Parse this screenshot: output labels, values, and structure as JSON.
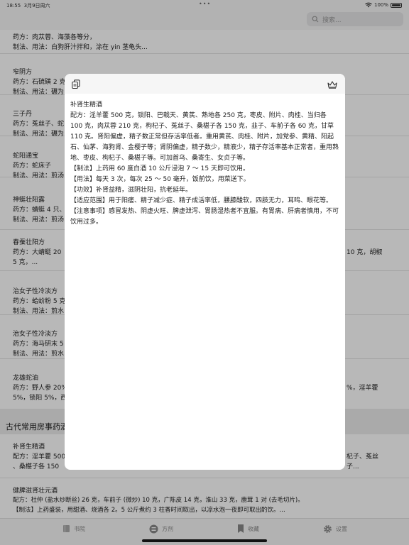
{
  "status_bar": {
    "time": "18:55",
    "date": "3月9日周六",
    "battery": "100%"
  },
  "search": {
    "placeholder": "搜索..."
  },
  "list": {
    "items": [
      {
        "title": "",
        "lines": [
          "药方：肉苁蓉、海藻各等分，",
          "制法、用法：白狗肝汁拌和，涂在 yin 茎龟头..."
        ]
      },
      {
        "title": "窄阴方",
        "lines": [
          "药方：石硫磺 2 克",
          "制法、用法：碾为"
        ]
      },
      {
        "title": "三子丹",
        "lines": [
          "药方：菟丝子、蛇",
          "制法、用法：碾为"
        ]
      },
      {
        "title": "蛇阳通宝",
        "lines": [
          "药方：蛇床子",
          "制法、用法：煎汤"
        ]
      },
      {
        "title": "神蜓壮阳露",
        "lines": [
          "药方：蜻蜓 4 只、",
          "制法、用法：煎汤"
        ]
      },
      {
        "title": "春蚕壮阳方",
        "lines": [
          "药方：大蜻蜓 20",
          "5 克，..."
        ],
        "right": "10 克，胡椒"
      },
      {
        "title": "治女子性冷淡方",
        "lines": [
          "药方：蛤蚧粉 5 克",
          "制法、用法：煎水"
        ]
      },
      {
        "title": "治女子性冷淡方",
        "lines": [
          "药方：海马研末 5",
          "制法、用法：煎水"
        ]
      },
      {
        "title": "龙雄蛇油",
        "lines": [
          "药方：野人参 20%",
          "5%，锁阳 5%，西"
        ],
        "right": "%，淫羊藿"
      }
    ],
    "section_title": "古代常用房事药酒",
    "section_items": [
      {
        "title": "补肾生精酒",
        "lines": [
          "配方：淫羊藿 500",
          "、桑椹子各 150"
        ],
        "right": [
          "杞子、菟丝",
          "子..."
        ]
      },
      {
        "title": "健脾滋肾壮元酒",
        "lines": [
          "配方：杜仲 (盐水炒断丝) 26 克，车前子 (微炒) 10 克，广陈皮 14 克，淮山 33 克，鹿茸 1 对 (去毛切片)。",
          "【制法】上药盛装，用甜酒、烧酒各 2。5 公斤煮约 3 柱香时间取出，以凉水泡一夜即可取出酌饮。..."
        ]
      }
    ]
  },
  "tab_bar": {
    "tabs": [
      {
        "label": "书院",
        "icon": "book-icon"
      },
      {
        "label": "方剂",
        "icon": "list-icon"
      },
      {
        "label": "收藏",
        "icon": "bookmark-icon"
      },
      {
        "label": "设置",
        "icon": "gear-icon"
      }
    ]
  },
  "modal": {
    "title": "补肾生精酒",
    "paragraphs": [
      "配方：淫羊藿 500 克，锁阳、巴戟天、黄芪、熟地各 250 克，枣皮、附片、肉桂、当归各 100 克，肉苁蓉 210 克，枸杞子、菟丝子、桑椹子各 150 克，韭子、车前子各 60 克，甘草 110 克。肾阳偏虚，精子数正常但存活率低者。重用黄芪、肉桂、附片，加党参、黄精、阳起石、仙茅、海狗肾、金樱子等；肾阴偏虚，精子数少，精液少，精子存活率基本正常者，重用熟地、枣皮、枸杞子、桑椹子等。可加首乌、桑寄生、女贞子等。",
      "【制法】上药用 60 度白酒 10 公斤浸泡 7 ～ 15 天即可饮用。",
      "【用法】每天 3 次，每次 25 ～ 50 毫升，饭前饮，用菜送下。",
      "【功效】补肾益精，滋阴壮阳，抗老延年。",
      "【适应范围】用于阳痿、精子减少症、精子成活率低，腰膝酸软，四肢无力，耳鸣、眼花等。",
      "【注意事项】感冒发热、阴虚火旺、脾虚泄泻、胃肠湿热者不宜服。有胃病、肝病者慎用，不可饮用过多。"
    ]
  },
  "colors": {
    "accent": "#333333",
    "overlay": "rgba(0,0,0,0.28)"
  }
}
